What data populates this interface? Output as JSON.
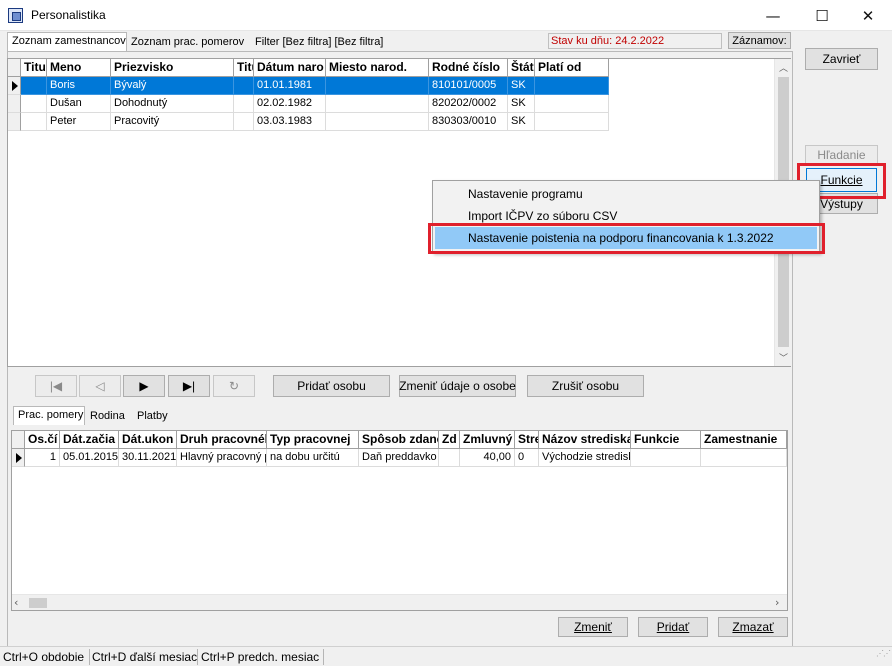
{
  "window": {
    "title": "Personalistika",
    "minimize": "—",
    "maximize": "☐",
    "close": "✕"
  },
  "top_tabs": [
    "Zoznam zamestnancov",
    "Zoznam prac. pomerov",
    "Filter [Bez filtra] [Bez filtra]"
  ],
  "state_date": "Stav ku dňu: 24.2.2022",
  "records_button": "Záznamov:",
  "right_buttons": {
    "close": "Zavrieť",
    "search": "Hľadanie",
    "functions": "Funkcie",
    "outputs": "Výstupy"
  },
  "persons": {
    "columns": [
      "Titu",
      "Meno",
      "Priezvisko",
      "Titu",
      "Dátum naro",
      "Miesto narod.",
      "Rodné číslo",
      "Štát",
      "Platí od"
    ],
    "rows": [
      [
        "",
        "Boris",
        "Bývalý",
        "",
        "01.01.1981",
        "",
        "810101/0005",
        "SK",
        ""
      ],
      [
        "",
        "Dušan",
        "Dohodnutý",
        "",
        "02.02.1982",
        "",
        "820202/0002",
        "SK",
        ""
      ],
      [
        "",
        "Peter",
        "Pracovitý",
        "",
        "03.03.1983",
        "",
        "830303/0010",
        "SK",
        ""
      ]
    ]
  },
  "nav_icons": [
    "first-icon",
    "prev-icon",
    "next-icon",
    "last-icon",
    "refresh-icon"
  ],
  "nav_glyphs": [
    "|◀",
    "◁",
    "▶",
    "▶|",
    "↻"
  ],
  "person_actions": {
    "add": "Pridať osobu",
    "edit": "Zmeniť údaje o osobe",
    "cancel": "Zrušiť osobu"
  },
  "bottom_tabs": [
    "Prac. pomery",
    "Rodina",
    "Platby"
  ],
  "employment": {
    "columns": [
      "Os.čí",
      "Dát.začia",
      "Dát.ukon",
      "Druh pracovnél",
      "Typ pracovnej",
      "Spôsob zdane",
      "Zd",
      "Zmluvný",
      "Stre",
      "Názov strediska",
      "Funkcie",
      "Zamestnanie"
    ],
    "rows": [
      [
        "1",
        "05.01.2015",
        "30.11.2021",
        "Hlavný pracovný p",
        "na dobu určitú",
        "Daň preddavko",
        "",
        "40,00",
        "0",
        "Východzie stredisk",
        "",
        ""
      ]
    ]
  },
  "bottom_actions": {
    "edit": "Zmeniť",
    "add": "Pridať",
    "delete": "Zmazať"
  },
  "context_menu": [
    "Nastavenie programu",
    "Import IČPV zo súboru CSV",
    "Nastavenie poistenia na podporu financovania k 1.3.2022"
  ],
  "status_bar": [
    "Ctrl+O obdobie",
    "Ctrl+D ďalší mesiac",
    "Ctrl+P predch. mesiac"
  ],
  "colors": {
    "selection": "#0078d7",
    "highlight_box": "#e0202c",
    "menu_highlight": "#91c9f7",
    "state_date_text": "#c00000"
  }
}
